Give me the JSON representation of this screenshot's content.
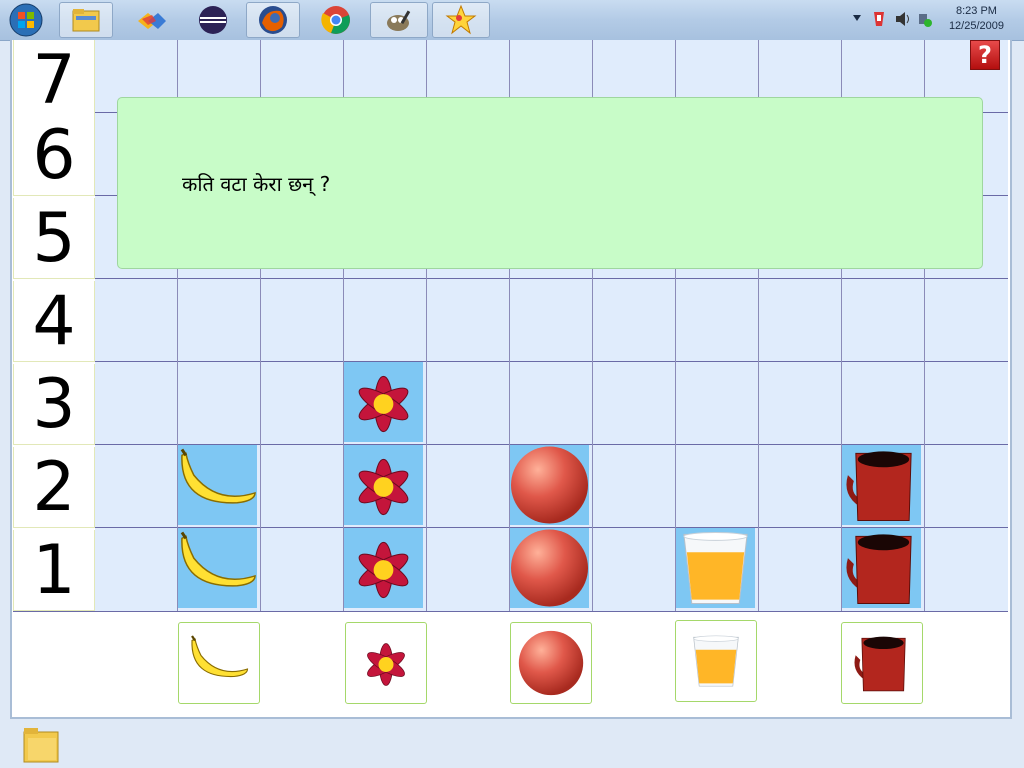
{
  "taskbar": {
    "apps": [
      {
        "name": "start-button",
        "icon": "windows-orb-icon"
      },
      {
        "name": "explorer",
        "icon": "folder-icon"
      },
      {
        "name": "childsplay",
        "icon": "kite-icon"
      },
      {
        "name": "eclipse",
        "icon": "eclipse-icon"
      },
      {
        "name": "firefox",
        "icon": "firefox-icon"
      },
      {
        "name": "chrome",
        "icon": "chrome-icon"
      },
      {
        "name": "gimp",
        "icon": "gimp-icon"
      },
      {
        "name": "tuxmath",
        "icon": "star-icon"
      }
    ],
    "clock": {
      "time": "8:23 PM",
      "date": "12/25/2009"
    }
  },
  "game": {
    "y_axis": [
      "7",
      "6",
      "5",
      "4",
      "3",
      "2",
      "1"
    ],
    "question": "कति वटा केरा छन् ?",
    "help_label": "?",
    "bars": [
      {
        "item": "banana",
        "count": 2
      },
      {
        "item": "flower",
        "count": 3
      },
      {
        "item": "ball",
        "count": 2
      },
      {
        "item": "juice",
        "count": 1
      },
      {
        "item": "mug",
        "count": 2
      }
    ],
    "choices": [
      "banana",
      "flower",
      "ball",
      "juice",
      "mug"
    ]
  },
  "colors": {
    "grid_bg": "#e0ecfc",
    "filled_cell": "#7ec7f3",
    "question_bg": "#c8fcc8",
    "help_bg": "#c41a1a"
  }
}
